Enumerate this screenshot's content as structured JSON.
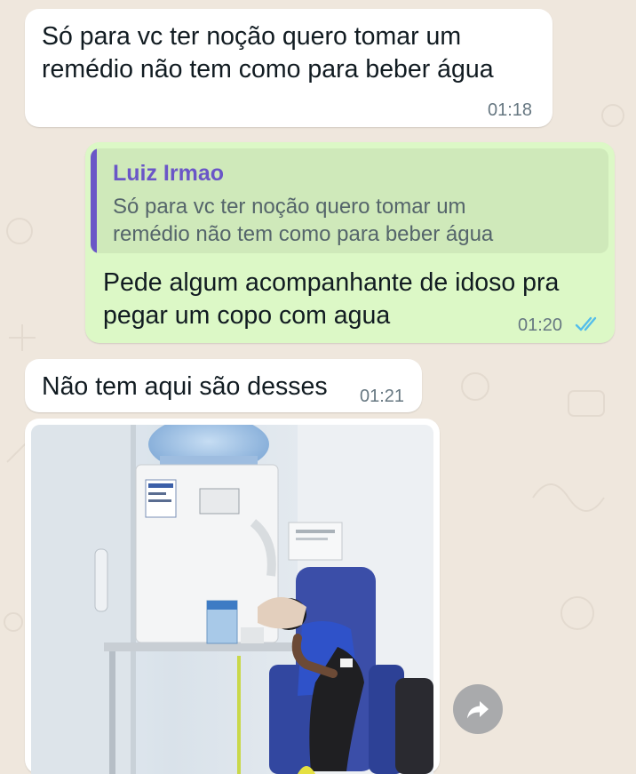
{
  "chat": {
    "messages": [
      {
        "direction": "incoming",
        "lines": [
          "Só para vc ter noção quero tomar um",
          "remédio não tem como para beber água"
        ],
        "time": "01:18"
      },
      {
        "direction": "outgoing",
        "quote": {
          "author": "Luiz Irmao",
          "lines": [
            "Só para vc ter noção quero tomar um",
            "remédio não tem como para beber água"
          ]
        },
        "lines": [
          "Pede algum  acompanhante de idoso pra",
          "pegar um copo com agua"
        ],
        "time": "01:20",
        "status_icon": "double-check-read-icon"
      },
      {
        "direction": "incoming",
        "text": "Não tem aqui são desses",
        "time": "01:21"
      },
      {
        "direction": "incoming",
        "type": "image",
        "image_icon": "hospital-water-dispenser-photo"
      }
    ],
    "forward_icon": "forward-arrow-icon"
  },
  "colors": {
    "background": "#efe7dd",
    "incoming_bubble": "#ffffff",
    "outgoing_bubble": "#dcf8c6",
    "quote_accent": "#6a56c7",
    "read_ticks": "#53bdeb"
  }
}
